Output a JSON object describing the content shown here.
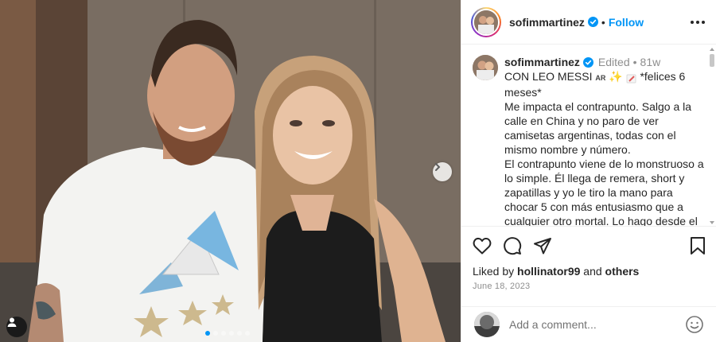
{
  "post": {
    "username": "sofimmartinez",
    "follow_label": "Follow",
    "separator": "•"
  },
  "caption": {
    "username": "sofimmartinez",
    "edited": "Edited",
    "dot": "•",
    "age": "81w",
    "title_line": "CON LEO MESSI",
    "flag_text": "AR",
    "emoji_text": "✨",
    "tail": "*felices 6 meses*",
    "paragraph1": "Me impacta el contrapunto. Salgo a la calle en China y no paro de ver camisetas argentinas, todas con el mismo nombre y número.",
    "paragraph2": "El contrapunto viene de lo monstruoso a lo simple. Él llega de remera, short y zapatillas y yo le tiro la mano para chocar 5 con más entusiasmo que a cualquier otro mortal. Lo hago desde el"
  },
  "likes": {
    "prefix": "Liked by",
    "user": "hollinator99",
    "and": "and",
    "others": "others"
  },
  "date": "June 18, 2023",
  "comment": {
    "placeholder": "Add a comment..."
  },
  "carousel": {
    "total_slides": 6,
    "active_index": 0
  },
  "colors": {
    "accent": "#0095f6",
    "text": "#262626",
    "muted": "#8e8e8e"
  },
  "icons": [
    "next-arrow-icon",
    "user-tag-icon",
    "verified-icon",
    "more-options-icon",
    "heart-icon",
    "comment-icon",
    "share-icon",
    "bookmark-icon",
    "emoji-icon"
  ]
}
